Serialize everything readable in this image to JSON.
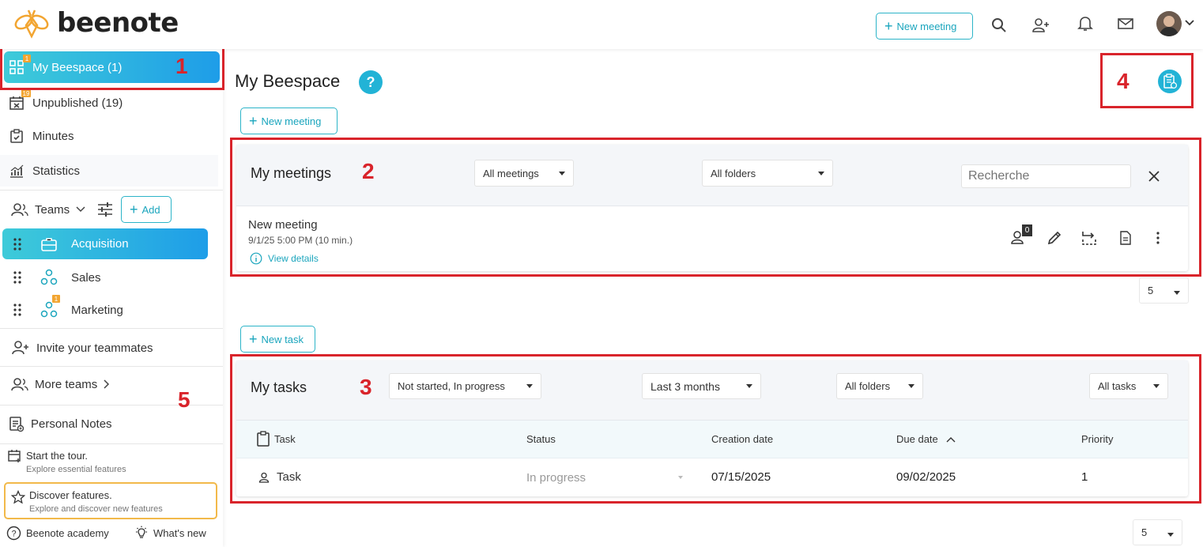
{
  "app": {
    "logo_text": "beenote"
  },
  "topbar": {
    "new_meeting_label": "New meeting"
  },
  "sidebar": {
    "my_beespace": {
      "label": "My Beespace (1)",
      "badge": "1"
    },
    "unpublished": {
      "label": "Unpublished (19)",
      "badge": "19"
    },
    "minutes": {
      "label": "Minutes"
    },
    "statistics": {
      "label": "Statistics"
    },
    "teams": {
      "label": "Teams",
      "add_label": "Add"
    },
    "team_items": [
      {
        "label": "Acquisition"
      },
      {
        "label": "Sales"
      },
      {
        "label": "Marketing",
        "badge": "1"
      }
    ],
    "invite": {
      "label": "Invite your teammates"
    },
    "more_teams": {
      "label": "More teams"
    },
    "personal_notes": {
      "label": "Personal Notes"
    },
    "tour": {
      "title": "Start the tour.",
      "subtitle": "Explore essential features"
    },
    "discover": {
      "title": "Discover features.",
      "subtitle": "Explore and discover new features"
    },
    "academy": {
      "label": "Beenote academy"
    },
    "whats_new": {
      "label": "What's new"
    }
  },
  "main": {
    "title": "My Beespace",
    "help": "?",
    "new_meeting_label": "New meeting",
    "new_task_label": "New task"
  },
  "meetings": {
    "title": "My meetings",
    "filter_meetings": "All meetings",
    "filter_folders": "All folders",
    "search_placeholder": "Recherche",
    "item": {
      "name": "New meeting",
      "datetime": "9/1/25 5:00 PM (10 min.)",
      "details_label": "View details",
      "participants_count": "0"
    },
    "page_size": "5"
  },
  "tasks": {
    "title": "My tasks",
    "filter_status": "Not started, In progress",
    "filter_range": "Last 3 months",
    "filter_folders": "All folders",
    "filter_tasks": "All tasks",
    "columns": {
      "task": "Task",
      "status": "Status",
      "creation": "Creation date",
      "due": "Due date",
      "priority": "Priority"
    },
    "rows": [
      {
        "task": "Task",
        "status": "In progress",
        "creation": "07/15/2025",
        "due": "09/02/2025",
        "priority": "1"
      }
    ],
    "page_size": "5"
  },
  "annotations": [
    "1",
    "2",
    "3",
    "4",
    "5"
  ],
  "colors": {
    "accent": "#1aa5bd",
    "gradient_start": "#3ecbd9",
    "gradient_end": "#1e9de8",
    "annotation_red": "#d9242b",
    "badge_orange": "#f2a531"
  }
}
